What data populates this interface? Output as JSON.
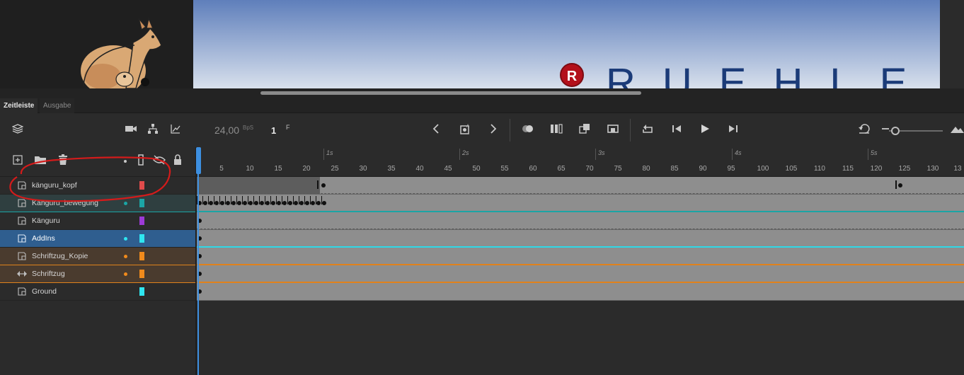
{
  "panels": {
    "tabs": [
      "Zeitleiste",
      "Ausgabe"
    ]
  },
  "stage": {
    "logo_letter": "R",
    "brand_text": "RUEHLE"
  },
  "toolbar": {
    "fps_value": "24,00",
    "fps_unit": "BpS",
    "frame_value": "1",
    "frame_unit": "F"
  },
  "ruler": {
    "seconds": [
      "1s",
      "2s",
      "3s",
      "4s",
      "5s"
    ],
    "frames": [
      "5",
      "10",
      "15",
      "20",
      "25",
      "30",
      "35",
      "40",
      "45",
      "50",
      "55",
      "60",
      "65",
      "70",
      "75",
      "80",
      "85",
      "90",
      "95",
      "100",
      "105",
      "110",
      "115",
      "120",
      "125",
      "130",
      "13"
    ]
  },
  "layers": [
    {
      "name": "känguru_kopf",
      "color": "#e04b4b",
      "dot": "",
      "type": "layer"
    },
    {
      "name": "Känguru_bewegung",
      "color": "#1ba5a5",
      "dot": "#1ba5a5",
      "type": "layer"
    },
    {
      "name": "Känguru",
      "color": "#9c3ad6",
      "dot": "",
      "type": "layer"
    },
    {
      "name": "AddIns",
      "color": "#2fe6f0",
      "dot": "#2fe6f0",
      "type": "layer"
    },
    {
      "name": "Schriftzug_Kopie",
      "color": "#f08a1c",
      "dot": "#f08a1c",
      "type": "layer"
    },
    {
      "name": "Schriftzug",
      "color": "#f08a1c",
      "dot": "#f08a1c",
      "type": "motion"
    },
    {
      "name": "Ground",
      "color": "#2fe6f0",
      "dot": "",
      "type": "layer"
    }
  ],
  "colors": {
    "accent": "#3d8fe0",
    "annotation": "#d41b1b"
  }
}
